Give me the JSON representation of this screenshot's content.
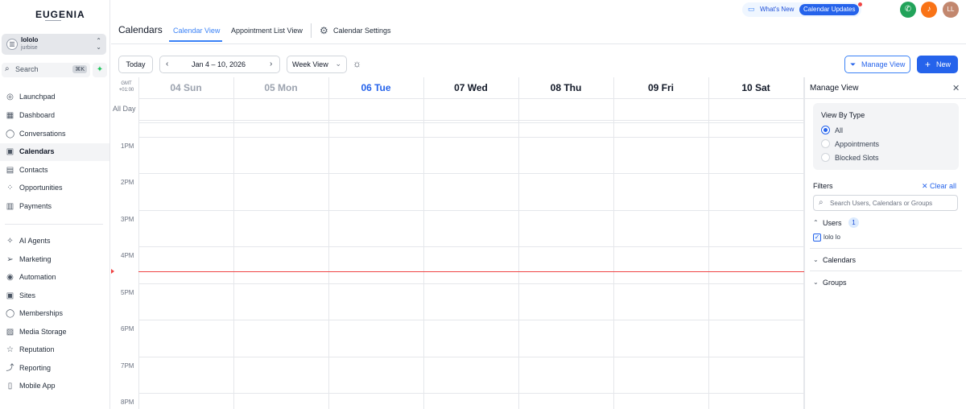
{
  "sidebar": {
    "logo": "EUGENIA",
    "account": {
      "name": "lololo",
      "subtitle": "jurbise",
      "avatar_icon": "building-icon"
    },
    "search": {
      "label": "Search",
      "shortcut": "⌘K"
    },
    "items": [
      {
        "label": "Launchpad",
        "icon": "launchpad-icon",
        "glyph": "◎"
      },
      {
        "label": "Dashboard",
        "icon": "dashboard-icon",
        "glyph": "▦"
      },
      {
        "label": "Conversations",
        "icon": "chat-icon",
        "glyph": "◯"
      },
      {
        "label": "Calendars",
        "icon": "calendar-icon",
        "glyph": "▣"
      },
      {
        "label": "Contacts",
        "icon": "contacts-icon",
        "glyph": "▤"
      },
      {
        "label": "Opportunities",
        "icon": "opportunities-icon",
        "glyph": "⁘"
      },
      {
        "label": "Payments",
        "icon": "payments-icon",
        "glyph": "▥"
      },
      {
        "label": "AI Agents",
        "icon": "sparkle-icon",
        "glyph": "✧"
      },
      {
        "label": "Marketing",
        "icon": "send-icon",
        "glyph": "➢"
      },
      {
        "label": "Automation",
        "icon": "automation-icon",
        "glyph": "◉"
      },
      {
        "label": "Sites",
        "icon": "sites-icon",
        "glyph": "▣"
      },
      {
        "label": "Memberships",
        "icon": "memberships-icon",
        "glyph": "◯"
      },
      {
        "label": "Media Storage",
        "icon": "image-icon",
        "glyph": "▨"
      },
      {
        "label": "Reputation",
        "icon": "star-icon",
        "glyph": "☆"
      },
      {
        "label": "Reporting",
        "icon": "trend-icon",
        "glyph": "⤴"
      },
      {
        "label": "Mobile App",
        "icon": "mobile-icon",
        "glyph": "▯"
      }
    ],
    "active_item": "Calendars"
  },
  "header": {
    "title": "Calendars",
    "tabs": [
      {
        "label": "Calendar View",
        "active": true
      },
      {
        "label": "Appointment List View",
        "active": false
      },
      {
        "label": "Calendar Settings",
        "active": false
      }
    ],
    "whats_new": "What's New",
    "updates_label": "Calendar Updates",
    "user_initials": "LL",
    "colors": {
      "accent": "#2563eb",
      "phone": "#22a35a",
      "bell": "#f97316",
      "avatar": "#c2876e"
    }
  },
  "toolbar": {
    "today": "Today",
    "date_range": "Jan 4 – 10, 2026",
    "view_select": "Week View",
    "manage_view": "Manage View",
    "new_label": "New"
  },
  "calendar": {
    "timezone": [
      "GMT",
      "+01:00"
    ],
    "all_day": "All Day",
    "days": [
      {
        "label": "04 Sun",
        "state": "past"
      },
      {
        "label": "05 Mon",
        "state": "past"
      },
      {
        "label": "06 Tue",
        "state": "today"
      },
      {
        "label": "07 Wed",
        "state": "future"
      },
      {
        "label": "08 Thu",
        "state": "future"
      },
      {
        "label": "09 Fri",
        "state": "future"
      },
      {
        "label": "10 Sat",
        "state": "future"
      }
    ],
    "hours": [
      "1PM",
      "2PM",
      "3PM",
      "4PM",
      "5PM",
      "6PM",
      "7PM",
      "8PM"
    ]
  },
  "manage_view": {
    "title": "Manage View",
    "view_by_type": {
      "title": "View By Type",
      "options": [
        "All",
        "Appointments",
        "Blocked Slots"
      ],
      "selected": "All"
    },
    "filters_label": "Filters",
    "clear_all": "Clear all",
    "search_placeholder": "Search Users, Calendars or Groups",
    "users": {
      "label": "Users",
      "count": "1",
      "items": [
        "lolo lo"
      ]
    },
    "calendars_label": "Calendars",
    "groups_label": "Groups"
  }
}
